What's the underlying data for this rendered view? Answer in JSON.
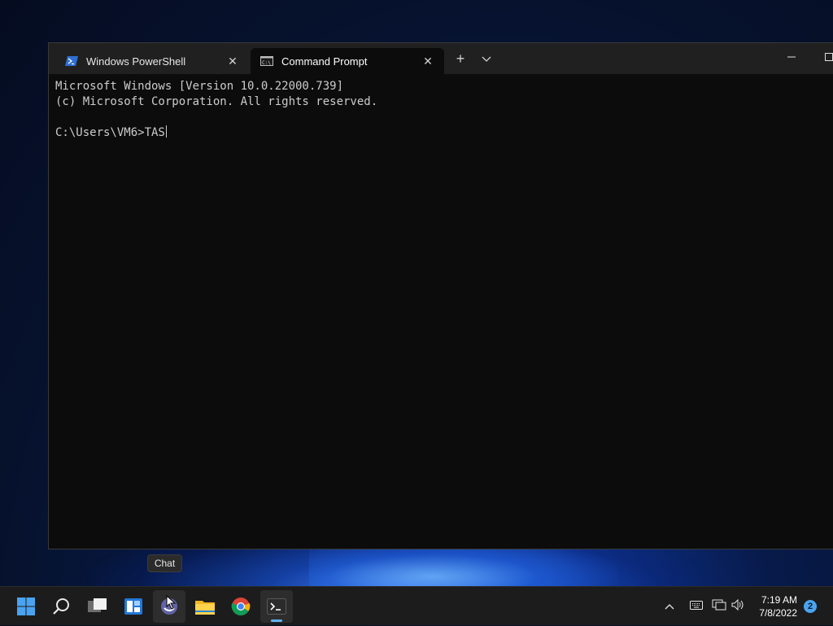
{
  "window": {
    "tabs": [
      {
        "label": "Windows PowerShell",
        "icon": "powershell-icon",
        "active": false
      },
      {
        "label": "Command Prompt",
        "icon": "cmd-icon",
        "active": true
      }
    ],
    "new_tab_symbol": "+",
    "dropdown_symbol": "⌵",
    "minimize_symbol": "—",
    "maximize_symbol": "☐"
  },
  "console": {
    "lines": [
      "Microsoft Windows [Version 10.0.22000.739]",
      "(c) Microsoft Corporation. All rights reserved.",
      "",
      "C:\\Users\\VM6>TAS"
    ]
  },
  "tooltip": {
    "text": "Chat"
  },
  "taskbar": {
    "apps": [
      "start-icon",
      "search-icon",
      "task-view-icon",
      "widgets-icon",
      "chat-icon",
      "file-explorer-icon",
      "chrome-icon",
      "terminal-icon"
    ],
    "clock": {
      "time": "7:19 AM",
      "date": "7/8/2022"
    },
    "notification_count": "2"
  },
  "colors": {
    "accent": "#4aa3f0",
    "console_text": "#cccccc",
    "console_bg": "#0c0c0c"
  }
}
